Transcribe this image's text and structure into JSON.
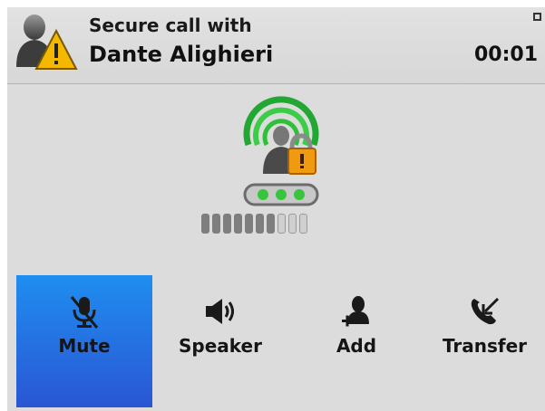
{
  "header": {
    "title": "Secure call with",
    "contact_name": "Dante Alighieri",
    "duration": "00:01",
    "caller_icon": "caller-warning-icon"
  },
  "status": {
    "icon": "secure-call-lock-icon",
    "volume": {
      "level": 7,
      "max": 10
    }
  },
  "actions": [
    {
      "label": "Mute",
      "icon": "microphone-muted-icon",
      "selected": true
    },
    {
      "label": "Speaker",
      "icon": "speaker-icon",
      "selected": false
    },
    {
      "label": "Add",
      "icon": "add-participant-icon",
      "selected": false
    },
    {
      "label": "Transfer",
      "icon": "transfer-call-icon",
      "selected": false
    }
  ],
  "colors": {
    "selected_top": "#1f8ef0",
    "selected_bottom": "#2a56d4",
    "warning": "#f5b800",
    "lock": "#f09a10",
    "signal": "#2fbf3a"
  }
}
